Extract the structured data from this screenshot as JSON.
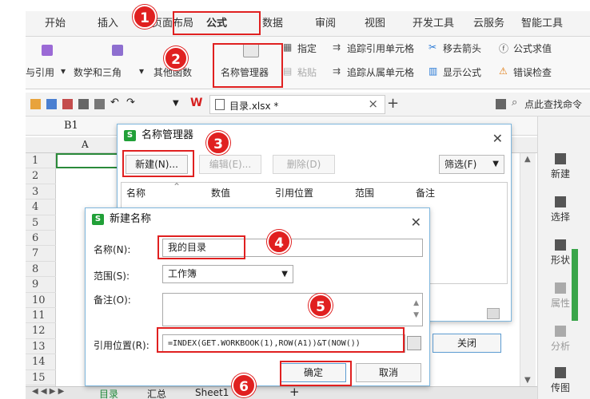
{
  "menu": {
    "tabs": [
      "开始",
      "插入",
      "页面布局",
      "公式",
      "数据",
      "审阅",
      "视图",
      "开发工具",
      "云服务",
      "智能工具"
    ],
    "active": "公式"
  },
  "ribbon": {
    "lookup_ref": "与引用",
    "math_trig": "数学和三角",
    "other_funcs": "其他函数",
    "name_manager": "名称管理器",
    "specify": "指定",
    "paste": "粘贴",
    "trace_precedents": "追踪引用单元格",
    "trace_dependents": "追踪从属单元格",
    "remove_arrows": "移去箭头",
    "show_formulas": "显示公式",
    "evaluate_formula": "公式求值",
    "error_check": "错误检查"
  },
  "toolbar": {
    "file_tab": "目录.xlsx *",
    "search": "点此查找命令"
  },
  "formula_bar": {
    "cell_ref": "B1"
  },
  "grid": {
    "col_a": "A",
    "rows": [
      "1",
      "2",
      "3",
      "4",
      "5",
      "6",
      "7",
      "8",
      "9",
      "10",
      "11",
      "12",
      "13",
      "14",
      "15"
    ]
  },
  "side_pane": {
    "items": [
      "新建",
      "选择",
      "形状",
      "属性",
      "分析",
      "传图"
    ]
  },
  "sheet_tabs": [
    "目录",
    "汇总",
    "Sheet1"
  ],
  "name_manager_dialog": {
    "title": "名称管理器",
    "new_button": "新建(N)...",
    "edit_button": "编辑(E)...",
    "delete_button": "删除(D)",
    "filter_button": "筛选(F)",
    "columns": [
      "名称",
      "数值",
      "引用位置",
      "范围",
      "备注"
    ],
    "close_button": "关闭"
  },
  "new_name_dialog": {
    "title": "新建名称",
    "name_label": "名称(N):",
    "name_value": "我的目录",
    "scope_label": "范围(S):",
    "scope_value": "工作簿",
    "comment_label": "备注(O):",
    "refers_to_label": "引用位置(R):",
    "refers_to_value": "=INDEX(GET.WORKBOOK(1),ROW(A1))&T(NOW())",
    "ok_button": "确定",
    "cancel_button": "取消"
  },
  "annotations": [
    "1",
    "2",
    "3",
    "4",
    "5",
    "6"
  ],
  "colors": {
    "annotation_red": "#e02020",
    "wps_green": "#21a038",
    "dialog_border": "#7fb7dd"
  }
}
